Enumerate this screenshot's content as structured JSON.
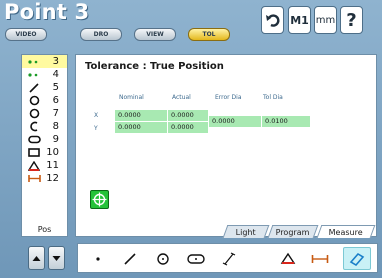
{
  "header": {
    "title": "Point 3",
    "mode_buttons": [
      {
        "label": "VIDEO"
      },
      {
        "label": "DRO"
      },
      {
        "label": "VIEW"
      },
      {
        "label": "TOL"
      }
    ],
    "icons": [
      {
        "name": "undo-icon",
        "glyph": "↶"
      },
      {
        "name": "memory-icon",
        "glyph": "M1"
      },
      {
        "name": "units-icon",
        "glyph": "mm"
      },
      {
        "name": "help-icon",
        "glyph": "?"
      }
    ]
  },
  "sidebar": {
    "items": [
      {
        "num": "3",
        "icon": "point-icon",
        "selected": true
      },
      {
        "num": "4",
        "icon": "point-icon",
        "selected": false
      },
      {
        "num": "5",
        "icon": "line-icon",
        "selected": false
      },
      {
        "num": "6",
        "icon": "circle-icon",
        "selected": false
      },
      {
        "num": "7",
        "icon": "circle-icon",
        "selected": false
      },
      {
        "num": "8",
        "icon": "arc-icon",
        "selected": false
      },
      {
        "num": "9",
        "icon": "slot-icon",
        "selected": false
      },
      {
        "num": "10",
        "icon": "rectangle-icon",
        "selected": false
      },
      {
        "num": "11",
        "icon": "angle-icon",
        "selected": false
      },
      {
        "num": "12",
        "icon": "distance-icon",
        "selected": false
      }
    ],
    "footer_label": "Pos"
  },
  "main": {
    "title": "Tolerance : True Position",
    "columns": [
      "Nominal",
      "Actual",
      "Error Dia",
      "Tol Dia"
    ],
    "rows": [
      {
        "label": "X",
        "nominal": "0.0000",
        "actual": "0.0000"
      },
      {
        "label": "Y",
        "nominal": "0.0000",
        "actual": "0.0000"
      }
    ],
    "error_dia": "0.0000",
    "tol_dia": "0.0100",
    "tabs": [
      {
        "label": "Light",
        "active": false
      },
      {
        "label": "Program",
        "active": false
      },
      {
        "label": "Measure",
        "active": true
      }
    ]
  },
  "toolbar": {
    "tools": [
      "point-tool",
      "line-tool",
      "circle-tool",
      "slot-tool",
      "distance-tool",
      "angle-tool",
      "width-tool",
      "skew-tool"
    ],
    "selected": "skew-tool"
  },
  "colors": {
    "accent_yellow": "#e3b81c",
    "result_green": "#a8e9b2",
    "selection_yellow": "#fffaa0",
    "target_green": "#25c239"
  }
}
